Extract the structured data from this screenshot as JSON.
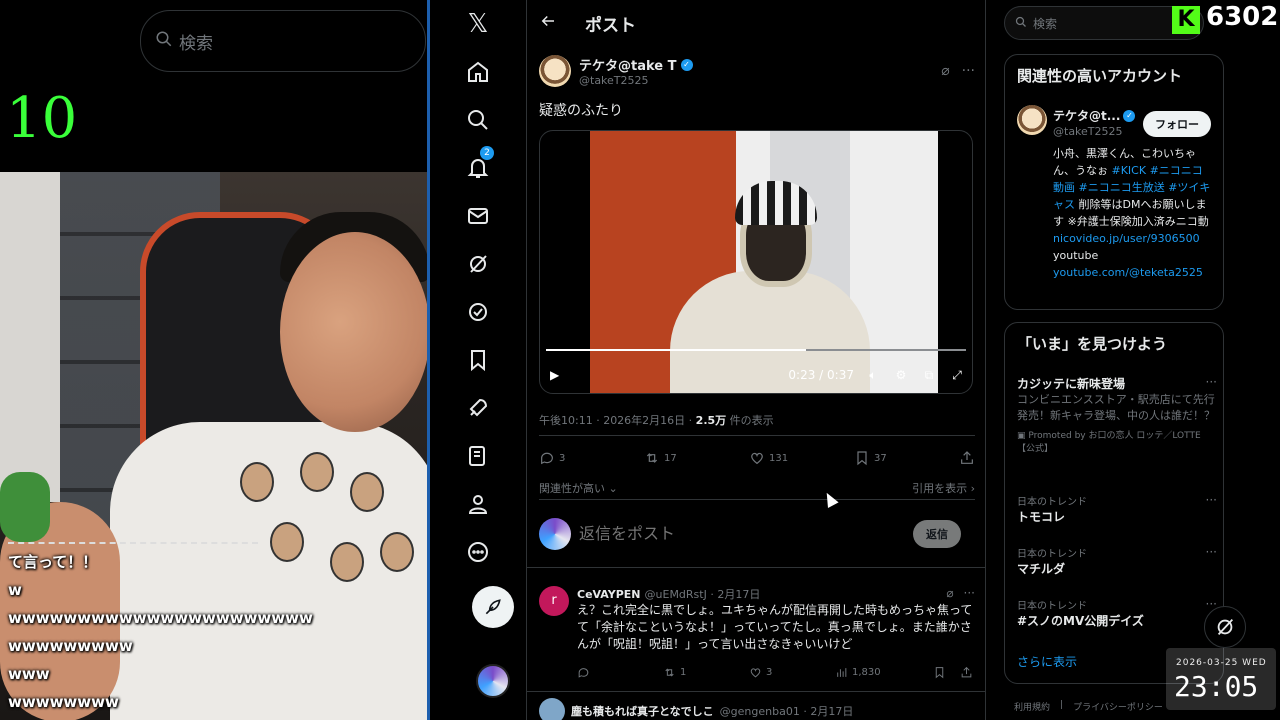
{
  "left_overlay": {
    "search_placeholder": "検索",
    "counter": "10",
    "comments": [
      "て言って！！",
      "w",
      "wwwwwwwwwwwwwwwwwwwwww",
      "wwwwwwwww",
      "www",
      "wwwwwwww"
    ]
  },
  "nav": {
    "logo": "𝕏",
    "notification_count": "2"
  },
  "header": {
    "title": "ポスト"
  },
  "post": {
    "author_name": "テケタ@take T",
    "author_handle": "@takeT2525",
    "text": "疑惑のふたり",
    "video": {
      "time": "0:23 / 0:37",
      "progress": 0.62
    },
    "timestamp": "午後10:11 · 2026年2月16日 · ",
    "views": "2.5万",
    "views_suffix": " 件の表示",
    "actions": {
      "replies": "3",
      "reposts": "17",
      "likes": "131",
      "bookmarks": "37"
    },
    "relevance_label": "関連性が高い",
    "quotes_label": "引用を表示"
  },
  "reply_box": {
    "placeholder": "返信をポスト",
    "button": "返信"
  },
  "replies": [
    {
      "avatar_letter": "r",
      "name": "CeVAYPEN",
      "handle": "@uEMdRstJ · 2月17日",
      "text": "え？これ完全に黒でしょ。ユキちゃんが配信再開した時もめっちゃ焦ってて「余計なこというなよ！」っていってたし。真っ黒でしょ。また誰かさんが「呪詛！呪詛！」って言い出さなきゃいいけど",
      "reposts": "1",
      "likes": "3",
      "views": "1,830"
    },
    {
      "name": "塵も積もれば真子となでしこ",
      "handle": "@gengenba01 · 2月17日"
    }
  ],
  "right": {
    "search_placeholder": "検索",
    "accounts_title": "関連性の高いアカウント",
    "account": {
      "name": "テケタ@t...",
      "handle": "@takeT2525",
      "follow_label": "フォロー",
      "bio_text": "小舟、黒澤くん、こわいちゃん、うなぉ ",
      "bio_tags": "#KICK #ニコニコ動画 #ニコニコ生放送 #ツイキャス",
      "bio_rest": " 削除等はDMへお願いします ※弁護士保険加入済みニコ動",
      "link1": "nicovideo.jp/user/9306500",
      "bio_youtube": "youtube",
      "link2": "youtube.com/@teketa2525"
    },
    "trends_title": "「いま」を見つけよう",
    "trends": [
      {
        "title": "カジッテに新味登場",
        "desc": "コンビニエンスストア・駅売店にて先行発売！新キャラ登場、中の人は誰だ！？",
        "promo": "Promoted by お口の恋人 ロッテ／LOTTE【公式】"
      },
      {
        "meta": "日本のトレンド",
        "title": "トモコレ"
      },
      {
        "meta": "日本のトレンド",
        "title": "マチルダ"
      },
      {
        "meta": "日本のトレンド",
        "title": "#スノのMV公開デイズ"
      }
    ],
    "show_more": "さらに表示",
    "footer": [
      "利用規約",
      "プライバシーポリシー"
    ]
  },
  "stream_overlay": {
    "kick_letter": "K",
    "viewer_count": "6302",
    "clock_date": "2026-03-25 WED",
    "clock_time": "23:05"
  }
}
